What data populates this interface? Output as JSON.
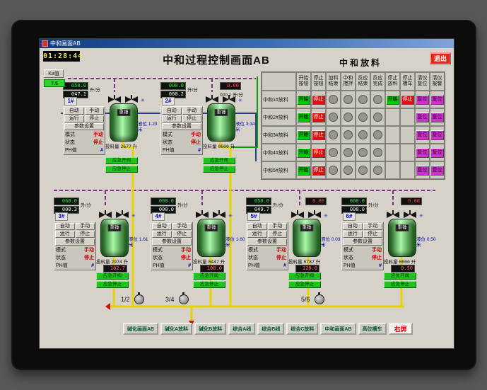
{
  "window": {
    "titlebar": "中和画面AB"
  },
  "header": {
    "clock": "01:28:44",
    "title": "中和过程控制画面AB",
    "section_title": "中和放料",
    "exit_label": "退出",
    "ka_label": "Ka值",
    "ka_value": "7.5"
  },
  "table": {
    "columns": [
      "开始按钮",
      "停止按钮",
      "加料结束",
      "中和搅拌",
      "反应结束",
      "反应完成",
      "停止放料",
      "停止槽车",
      "清仪复位",
      "清仪报警"
    ],
    "button_labels": {
      "start": "开始",
      "stop": "停止",
      "reset": "复位"
    },
    "rows": [
      {
        "label": "中和1#放料",
        "cells": [
          "start",
          "stop",
          "ind",
          "ind",
          "ind",
          "ind",
          "start",
          "stop",
          "reset",
          "reset"
        ]
      },
      {
        "label": "中和2#放料",
        "cells": [
          "start",
          "stop",
          "ind",
          "ind",
          "ind",
          "ind",
          "none",
          "none",
          "reset",
          "reset"
        ]
      },
      {
        "label": "中和3#放料",
        "cells": [
          "start",
          "stop",
          "ind",
          "ind",
          "ind",
          "ind",
          "none",
          "none",
          "reset",
          "reset"
        ]
      },
      {
        "label": "中和4#放料",
        "cells": [
          "start",
          "stop",
          "ind",
          "ind",
          "ind",
          "ind",
          "none",
          "none",
          "reset",
          "reset"
        ]
      },
      {
        "label": "中和5#放料",
        "cells": [
          "start",
          "stop",
          "ind",
          "ind",
          "ind",
          "ind",
          "none",
          "none",
          "reset",
          "reset"
        ]
      }
    ]
  },
  "tank_labels": {
    "auto": "自动",
    "manual": "手动",
    "run": "运行",
    "stop": "停止",
    "params": "参数设置",
    "mode": "模式",
    "mode_value": "手动",
    "state": "状态",
    "state_value": "停止",
    "ph": "PH值",
    "ph_value": "#",
    "flow_unit": "升/分",
    "feed_label": "投料量",
    "feed_unit": "升",
    "level_label": "液位",
    "level_unit": "米",
    "tank_tag": "重锤",
    "emg_open": "应急开阀",
    "emg_stop": "应急停止"
  },
  "tanks": [
    {
      "id": "1#",
      "flow_set": "050.0",
      "flow_act": "047.1",
      "aux": null,
      "aux_flow": null,
      "feed": "2677",
      "weight": null,
      "level": "1.23"
    },
    {
      "id": "2#",
      "flow_set": "000.0",
      "flow_act": "000.2",
      "aux": "0.00",
      "aux_flow": "000.1",
      "feed": "0000",
      "weight": null,
      "level": "3.34"
    },
    {
      "id": "3#",
      "flow_set": "060.0",
      "flow_act": "000.3",
      "aux": null,
      "aux_flow": null,
      "feed": "2974",
      "weight": "102.7",
      "level": "1.61"
    },
    {
      "id": "4#",
      "flow_set": "000.0",
      "flow_act": "000.0",
      "aux": null,
      "aux_flow": null,
      "feed": "0447",
      "weight": "100.0",
      "level": "1.60"
    },
    {
      "id": "5#",
      "flow_set": "050.0",
      "flow_act": "049.7",
      "aux": "0.00",
      "aux_flow": null,
      "feed": "0787",
      "weight": "120.0",
      "level": "0.03"
    },
    {
      "id": "6#",
      "flow_set": "000.0",
      "flow_act": "000.0",
      "aux": "0.00",
      "aux_flow": null,
      "feed": "0000",
      "weight": "0.50",
      "level": "0.50"
    }
  ],
  "pumps": [
    "1/2",
    "3/4",
    "5/6"
  ],
  "bottom_bar": {
    "buttons": [
      "碱化画面AB",
      "碱化A放料",
      "碱化B放料",
      "综合A线",
      "综合B线",
      "综合C放料",
      "中和画面AB",
      "高位槽车",
      "右屏"
    ]
  },
  "colors": {
    "start": "#00cc00",
    "stop": "#e01010",
    "reset": "#cc33cc",
    "pipe": "#e6d400"
  }
}
